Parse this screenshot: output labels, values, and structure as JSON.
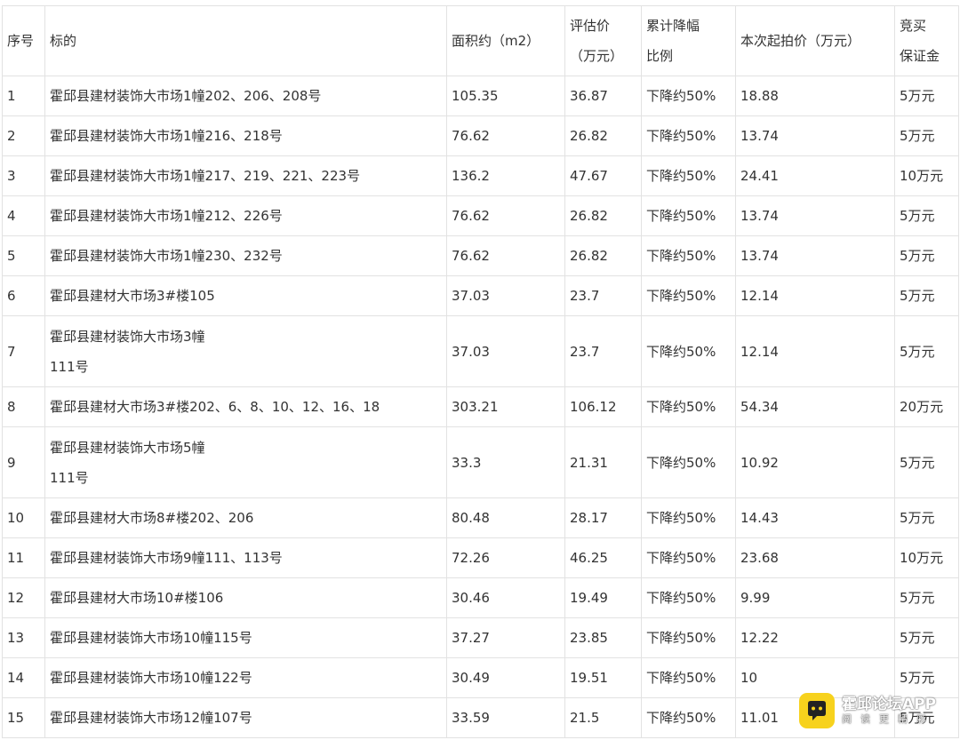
{
  "table": {
    "headers": {
      "no": "序号",
      "target": "标的",
      "area": "面积约（m2）",
      "appraisal_l1": "评估价",
      "appraisal_l2": "（万元）",
      "reduction_l1": "累计降幅",
      "reduction_l2": "比例",
      "start_price": "本次起拍价（万元）",
      "deposit_l1": "竞买",
      "deposit_l2": "保证金"
    },
    "rows": [
      {
        "no": "1",
        "target": "霍邱县建材装饰大市场1幢202、206、208号",
        "area": "105.35",
        "appraisal": "36.87",
        "reduction": "下降约50%",
        "start_price": "18.88",
        "deposit": "5万元"
      },
      {
        "no": "2",
        "target": "霍邱县建材装饰大市场1幢216、218号",
        "area": "76.62",
        "appraisal": "26.82",
        "reduction": "下降约50%",
        "start_price": "13.74",
        "deposit": "5万元"
      },
      {
        "no": "3",
        "target": "霍邱县建材装饰大市场1幢217、219、221、223号",
        "area": "136.2",
        "appraisal": "47.67",
        "reduction": "下降约50%",
        "start_price": "24.41",
        "deposit": "10万元"
      },
      {
        "no": "4",
        "target": "霍邱县建材装饰大市场1幢212、226号",
        "area": "76.62",
        "appraisal": "26.82",
        "reduction": "下降约50%",
        "start_price": "13.74",
        "deposit": "5万元"
      },
      {
        "no": "5",
        "target": "霍邱县建材装饰大市场1幢230、232号",
        "area": "76.62",
        "appraisal": "26.82",
        "reduction": "下降约50%",
        "start_price": "13.74",
        "deposit": "5万元"
      },
      {
        "no": "6",
        "target": "霍邱县建材大市场3#楼105",
        "area": "37.03",
        "appraisal": "23.7",
        "reduction": "下降约50%",
        "start_price": "12.14",
        "deposit": "5万元"
      },
      {
        "no": "7",
        "target_l1": "霍邱县建材装饰大市场3幢",
        "target_l2": "111号",
        "area": "37.03",
        "appraisal": "23.7",
        "reduction": "下降约50%",
        "start_price": "12.14",
        "deposit": "5万元"
      },
      {
        "no": "8",
        "target": "霍邱县建材大市场3#楼202、6、8、10、12、16、18",
        "area": "303.21",
        "appraisal": "106.12",
        "reduction": "下降约50%",
        "start_price": "54.34",
        "deposit": "20万元"
      },
      {
        "no": "9",
        "target_l1": "霍邱县建材装饰大市场5幢",
        "target_l2": "111号",
        "area": "33.3",
        "appraisal": "21.31",
        "reduction": "下降约50%",
        "start_price": "10.92",
        "deposit": "5万元"
      },
      {
        "no": "10",
        "target": "霍邱县建材大市场8#楼202、206",
        "area": "80.48",
        "appraisal": "28.17",
        "reduction": "下降约50%",
        "start_price": "14.43",
        "deposit": "5万元"
      },
      {
        "no": "11",
        "target": "霍邱县建材装饰大市场9幢111、113号",
        "area": "72.26",
        "appraisal": "46.25",
        "reduction": "下降约50%",
        "start_price": "23.68",
        "deposit": "10万元"
      },
      {
        "no": "12",
        "target": "霍邱县建材大市场10#楼106",
        "area": "30.46",
        "appraisal": "19.49",
        "reduction": "下降约50%",
        "start_price": "9.99",
        "deposit": "5万元"
      },
      {
        "no": "13",
        "target": "霍邱县建材装饰大市场10幢115号",
        "area": "37.27",
        "appraisal": "23.85",
        "reduction": "下降约50%",
        "start_price": "12.22",
        "deposit": "5万元"
      },
      {
        "no": "14",
        "target": "霍邱县建材装饰大市场10幢122号",
        "area": "30.49",
        "appraisal": "19.51",
        "reduction": "下降约50%",
        "start_price": "10",
        "deposit": "5万元"
      },
      {
        "no": "15",
        "target": "霍邱县建材装饰大市场12幢107号",
        "area": "33.59",
        "appraisal": "21.5",
        "reduction": "下降约50%",
        "start_price": "11.01",
        "deposit": "5万元"
      }
    ]
  },
  "watermark": {
    "title": "霍邱论坛APP",
    "subtitle": "阅读更精彩",
    "icon": "chat-bubble-icon",
    "brand_color": "#f7d21d"
  }
}
